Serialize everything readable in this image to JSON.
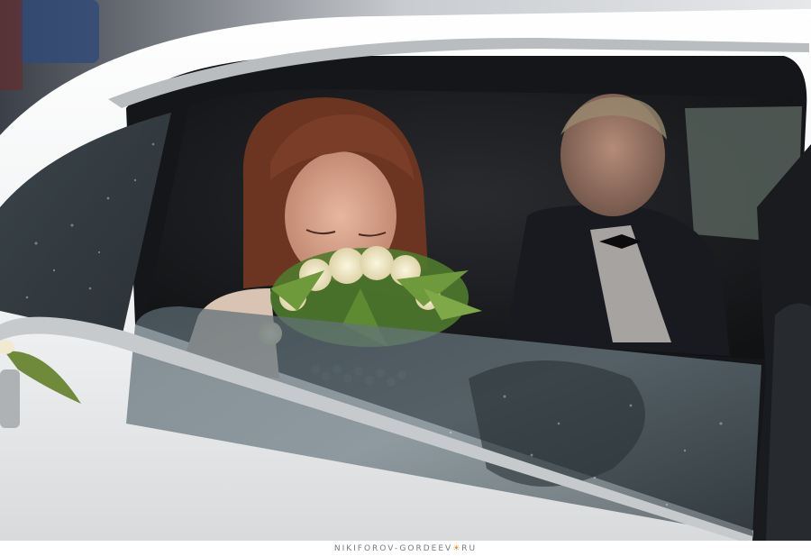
{
  "photo": {
    "subject": "photograph"
  },
  "watermark": {
    "part1": "NIKIFOROV-GORDEEV",
    "part2": "RU"
  },
  "colors": {
    "car_body": "#eef0f1",
    "window_dark": "#1c1d20",
    "glass": "#4e5e66",
    "hair": "#6b3522",
    "skin": "#d9a48b",
    "flowers": "#f3ecd2",
    "leaves": "#6f9a3c",
    "suit": "#191a1f",
    "accent": "#e58a1f"
  }
}
